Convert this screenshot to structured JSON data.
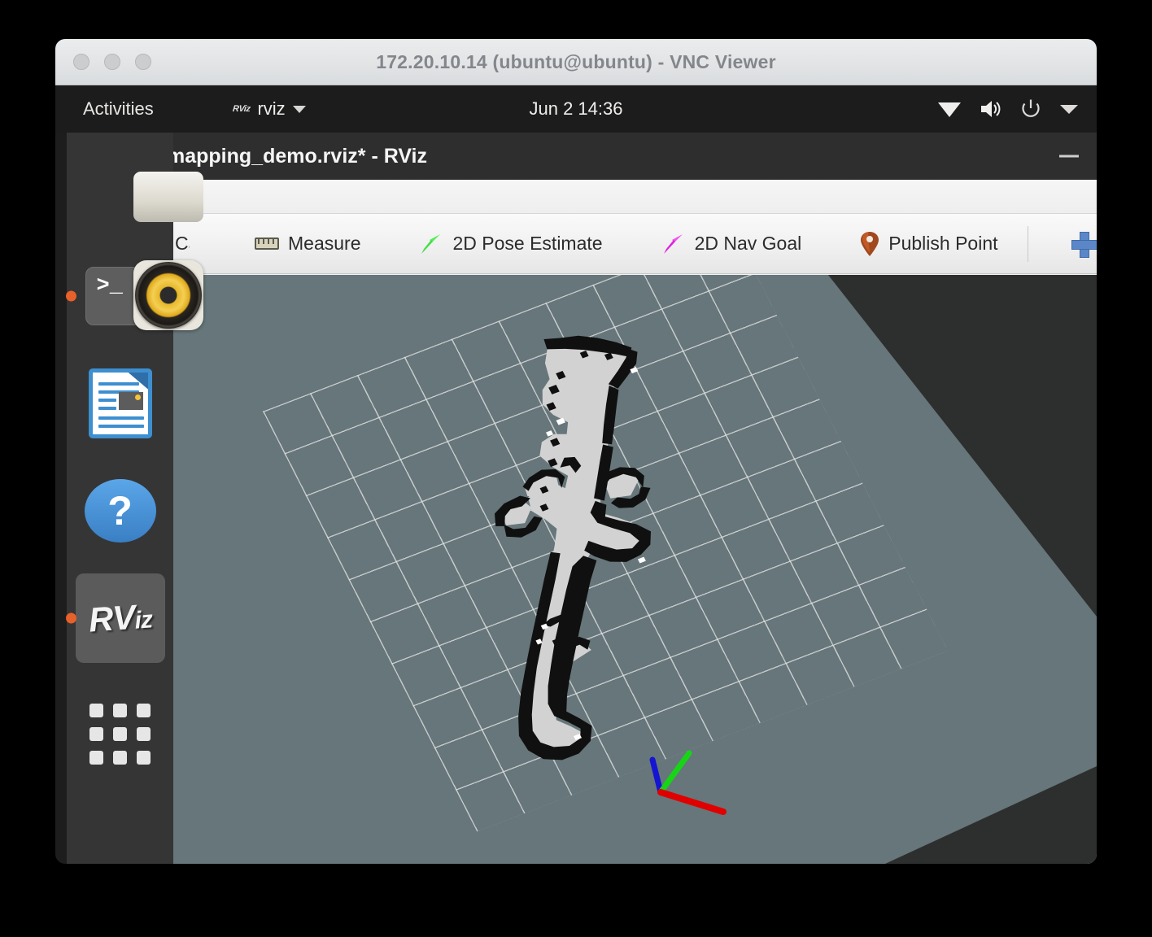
{
  "mac_window": {
    "title": "172.20.10.14 (ubuntu@ubuntu) - VNC Viewer",
    "traffic_lights": [
      "close-button",
      "minimize-button",
      "zoom-button"
    ],
    "tab_segments": 3
  },
  "gnome_topbar": {
    "activities_label": "Activities",
    "app_menu": {
      "logo_text": "RViz",
      "label": "rviz",
      "caret": "chevron-down-icon"
    },
    "clock": "Jun 2  14:36",
    "tray": [
      "wifi-icon",
      "volume-icon",
      "power-icon",
      "chevron-down-icon"
    ]
  },
  "dock": {
    "items": [
      {
        "name": "firefox",
        "icon": "speaker-ring-icon",
        "running": false,
        "active": false,
        "label": ""
      },
      {
        "name": "terminal",
        "icon": "terminal-icon",
        "running": true,
        "active": false,
        "label": ">_"
      },
      {
        "name": "libreoffice-impress",
        "icon": "document-icon",
        "running": false,
        "active": false,
        "label": ""
      },
      {
        "name": "help",
        "icon": "question-mark-icon",
        "running": false,
        "active": false,
        "label": "?"
      },
      {
        "name": "rviz",
        "icon": "rviz-logo-icon",
        "running": true,
        "active": true,
        "label_big": "RV",
        "label_small": "iz"
      },
      {
        "name": "show-applications",
        "icon": "app-grid-icon",
        "running": false,
        "active": false,
        "label": ""
      }
    ]
  },
  "rviz": {
    "title": "mapping_demo.rviz* - RViz",
    "minimize_label": "minimize",
    "toolbar": {
      "clipped_tool_label": "Car",
      "tools": [
        {
          "label": "Measure",
          "icon": "ruler-icon"
        },
        {
          "label": "2D Pose Estimate",
          "icon": "green-arrow-icon"
        },
        {
          "label": "2D Nav Goal",
          "icon": "magenta-arrow-icon"
        },
        {
          "label": "Publish Point",
          "icon": "map-pin-icon"
        }
      ],
      "right_buttons": [
        {
          "name": "add-tool-button",
          "icon": "plus-icon"
        },
        {
          "name": "remove-tool-button",
          "icon": "minus-icon"
        },
        {
          "name": "tool-visibility-button",
          "icon": "eye-icon"
        }
      ]
    },
    "viewport": {
      "background_color": "#66767a",
      "grid_color": "#e4e4e4",
      "occupied_color": "#111111",
      "free_color": "#d2d2d2",
      "axes": [
        {
          "name": "x-axis",
          "color": "#e00000"
        },
        {
          "name": "y-axis",
          "color": "#17d417"
        },
        {
          "name": "z-axis",
          "color": "#1414d2"
        }
      ],
      "grid_cells": 10
    }
  }
}
